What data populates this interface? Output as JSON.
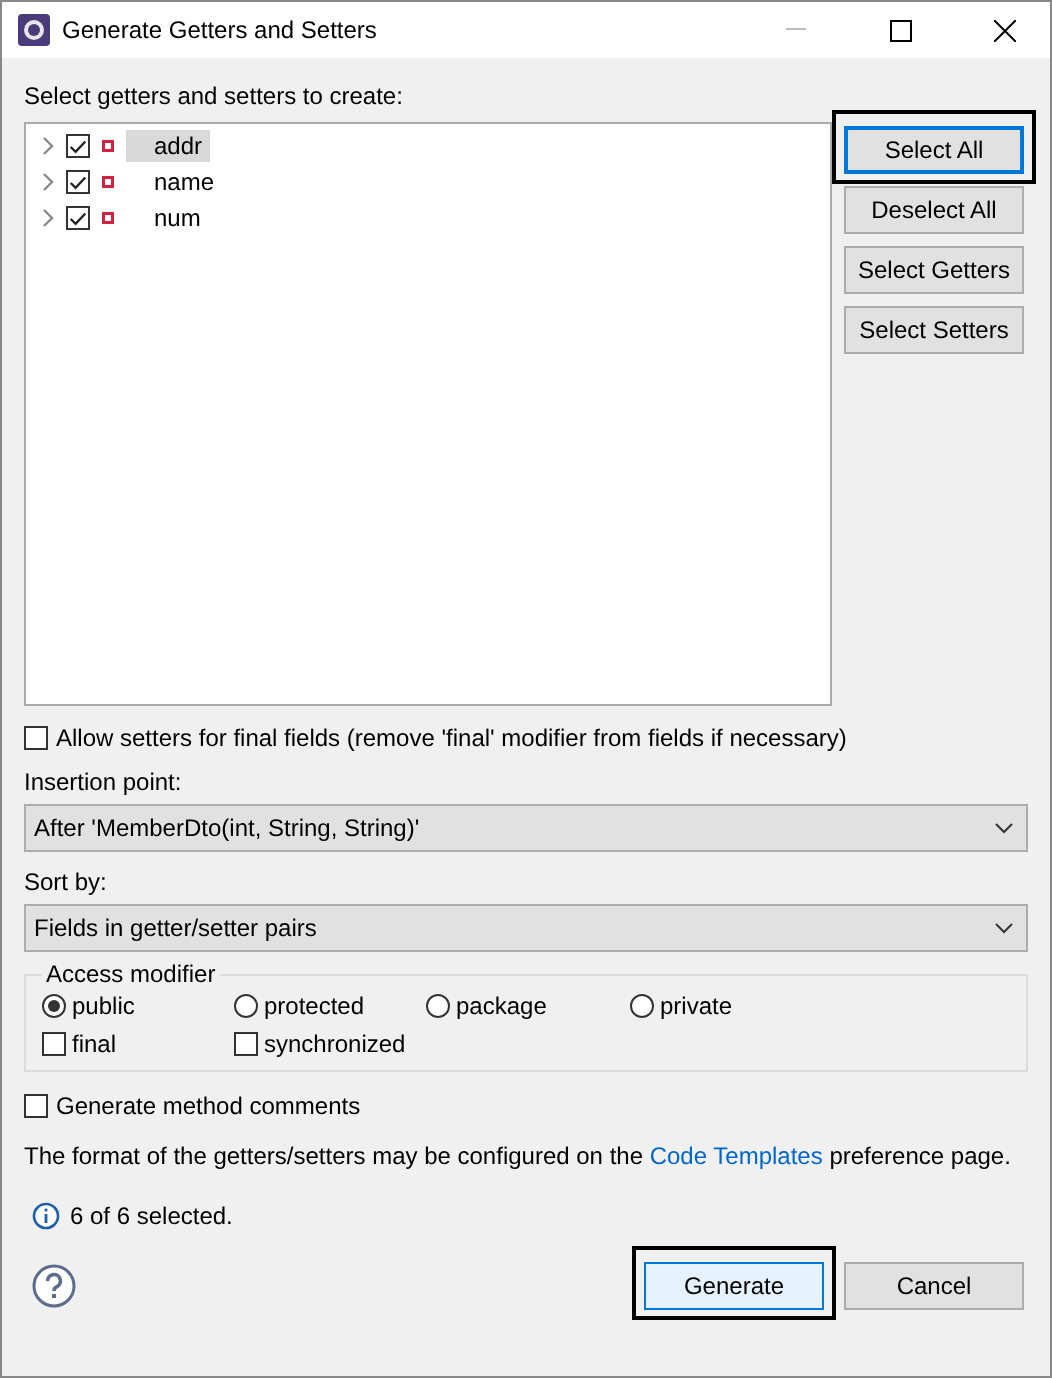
{
  "window": {
    "title": "Generate Getters and Setters"
  },
  "prompt": "Select getters and setters to create:",
  "fields": [
    {
      "name": "addr",
      "checked": true,
      "selected": true
    },
    {
      "name": "name",
      "checked": true,
      "selected": false
    },
    {
      "name": "num",
      "checked": true,
      "selected": false
    }
  ],
  "side_buttons": [
    {
      "label": "Select All",
      "focused": true,
      "highlighted": true
    },
    {
      "label": "Deselect All",
      "focused": false,
      "highlighted": false
    },
    {
      "label": "Select Getters",
      "focused": false,
      "highlighted": false
    },
    {
      "label": "Select Setters",
      "focused": false,
      "highlighted": false
    }
  ],
  "allow_final": {
    "label": "Allow setters for final fields (remove 'final' modifier from fields if necessary)",
    "checked": false
  },
  "insertion_point": {
    "label": "Insertion point:",
    "value": "After 'MemberDto(int, String, String)'"
  },
  "sort_by": {
    "label": "Sort by:",
    "value": "Fields in getter/setter pairs"
  },
  "access_modifier": {
    "legend": "Access modifier",
    "radios": [
      {
        "label": "public",
        "selected": true
      },
      {
        "label": "protected",
        "selected": false
      },
      {
        "label": "package",
        "selected": false
      },
      {
        "label": "private",
        "selected": false
      }
    ],
    "options": [
      {
        "label": "final",
        "checked": false
      },
      {
        "label": "synchronized",
        "checked": false
      }
    ]
  },
  "comments": {
    "label": "Generate method comments",
    "checked": false
  },
  "note": {
    "before": "The format of the getters/setters may be configured on the",
    "link": "Code Templates",
    "after": "preference page."
  },
  "status": "6 of 6 selected.",
  "footer_buttons": [
    {
      "label": "Generate",
      "focused": true,
      "highlighted": true
    },
    {
      "label": "Cancel",
      "focused": false,
      "highlighted": false
    }
  ]
}
